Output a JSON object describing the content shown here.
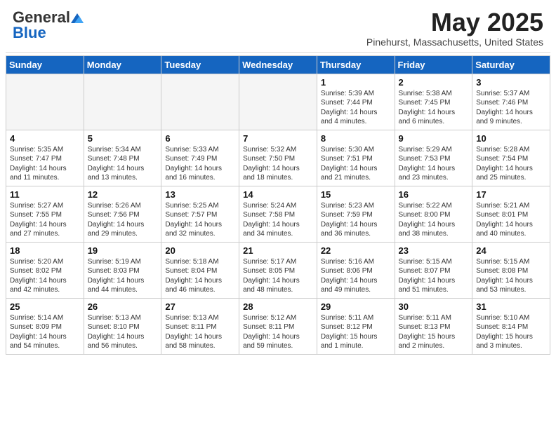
{
  "header": {
    "logo_general": "General",
    "logo_blue": "Blue",
    "month_title": "May 2025",
    "location": "Pinehurst, Massachusetts, United States"
  },
  "days_of_week": [
    "Sunday",
    "Monday",
    "Tuesday",
    "Wednesday",
    "Thursday",
    "Friday",
    "Saturday"
  ],
  "weeks": [
    [
      {
        "num": "",
        "info": ""
      },
      {
        "num": "",
        "info": ""
      },
      {
        "num": "",
        "info": ""
      },
      {
        "num": "",
        "info": ""
      },
      {
        "num": "1",
        "info": "Sunrise: 5:39 AM\nSunset: 7:44 PM\nDaylight: 14 hours\nand 4 minutes."
      },
      {
        "num": "2",
        "info": "Sunrise: 5:38 AM\nSunset: 7:45 PM\nDaylight: 14 hours\nand 6 minutes."
      },
      {
        "num": "3",
        "info": "Sunrise: 5:37 AM\nSunset: 7:46 PM\nDaylight: 14 hours\nand 9 minutes."
      }
    ],
    [
      {
        "num": "4",
        "info": "Sunrise: 5:35 AM\nSunset: 7:47 PM\nDaylight: 14 hours\nand 11 minutes."
      },
      {
        "num": "5",
        "info": "Sunrise: 5:34 AM\nSunset: 7:48 PM\nDaylight: 14 hours\nand 13 minutes."
      },
      {
        "num": "6",
        "info": "Sunrise: 5:33 AM\nSunset: 7:49 PM\nDaylight: 14 hours\nand 16 minutes."
      },
      {
        "num": "7",
        "info": "Sunrise: 5:32 AM\nSunset: 7:50 PM\nDaylight: 14 hours\nand 18 minutes."
      },
      {
        "num": "8",
        "info": "Sunrise: 5:30 AM\nSunset: 7:51 PM\nDaylight: 14 hours\nand 21 minutes."
      },
      {
        "num": "9",
        "info": "Sunrise: 5:29 AM\nSunset: 7:53 PM\nDaylight: 14 hours\nand 23 minutes."
      },
      {
        "num": "10",
        "info": "Sunrise: 5:28 AM\nSunset: 7:54 PM\nDaylight: 14 hours\nand 25 minutes."
      }
    ],
    [
      {
        "num": "11",
        "info": "Sunrise: 5:27 AM\nSunset: 7:55 PM\nDaylight: 14 hours\nand 27 minutes."
      },
      {
        "num": "12",
        "info": "Sunrise: 5:26 AM\nSunset: 7:56 PM\nDaylight: 14 hours\nand 29 minutes."
      },
      {
        "num": "13",
        "info": "Sunrise: 5:25 AM\nSunset: 7:57 PM\nDaylight: 14 hours\nand 32 minutes."
      },
      {
        "num": "14",
        "info": "Sunrise: 5:24 AM\nSunset: 7:58 PM\nDaylight: 14 hours\nand 34 minutes."
      },
      {
        "num": "15",
        "info": "Sunrise: 5:23 AM\nSunset: 7:59 PM\nDaylight: 14 hours\nand 36 minutes."
      },
      {
        "num": "16",
        "info": "Sunrise: 5:22 AM\nSunset: 8:00 PM\nDaylight: 14 hours\nand 38 minutes."
      },
      {
        "num": "17",
        "info": "Sunrise: 5:21 AM\nSunset: 8:01 PM\nDaylight: 14 hours\nand 40 minutes."
      }
    ],
    [
      {
        "num": "18",
        "info": "Sunrise: 5:20 AM\nSunset: 8:02 PM\nDaylight: 14 hours\nand 42 minutes."
      },
      {
        "num": "19",
        "info": "Sunrise: 5:19 AM\nSunset: 8:03 PM\nDaylight: 14 hours\nand 44 minutes."
      },
      {
        "num": "20",
        "info": "Sunrise: 5:18 AM\nSunset: 8:04 PM\nDaylight: 14 hours\nand 46 minutes."
      },
      {
        "num": "21",
        "info": "Sunrise: 5:17 AM\nSunset: 8:05 PM\nDaylight: 14 hours\nand 48 minutes."
      },
      {
        "num": "22",
        "info": "Sunrise: 5:16 AM\nSunset: 8:06 PM\nDaylight: 14 hours\nand 49 minutes."
      },
      {
        "num": "23",
        "info": "Sunrise: 5:15 AM\nSunset: 8:07 PM\nDaylight: 14 hours\nand 51 minutes."
      },
      {
        "num": "24",
        "info": "Sunrise: 5:15 AM\nSunset: 8:08 PM\nDaylight: 14 hours\nand 53 minutes."
      }
    ],
    [
      {
        "num": "25",
        "info": "Sunrise: 5:14 AM\nSunset: 8:09 PM\nDaylight: 14 hours\nand 54 minutes."
      },
      {
        "num": "26",
        "info": "Sunrise: 5:13 AM\nSunset: 8:10 PM\nDaylight: 14 hours\nand 56 minutes."
      },
      {
        "num": "27",
        "info": "Sunrise: 5:13 AM\nSunset: 8:11 PM\nDaylight: 14 hours\nand 58 minutes."
      },
      {
        "num": "28",
        "info": "Sunrise: 5:12 AM\nSunset: 8:11 PM\nDaylight: 14 hours\nand 59 minutes."
      },
      {
        "num": "29",
        "info": "Sunrise: 5:11 AM\nSunset: 8:12 PM\nDaylight: 15 hours\nand 1 minute."
      },
      {
        "num": "30",
        "info": "Sunrise: 5:11 AM\nSunset: 8:13 PM\nDaylight: 15 hours\nand 2 minutes."
      },
      {
        "num": "31",
        "info": "Sunrise: 5:10 AM\nSunset: 8:14 PM\nDaylight: 15 hours\nand 3 minutes."
      }
    ]
  ]
}
